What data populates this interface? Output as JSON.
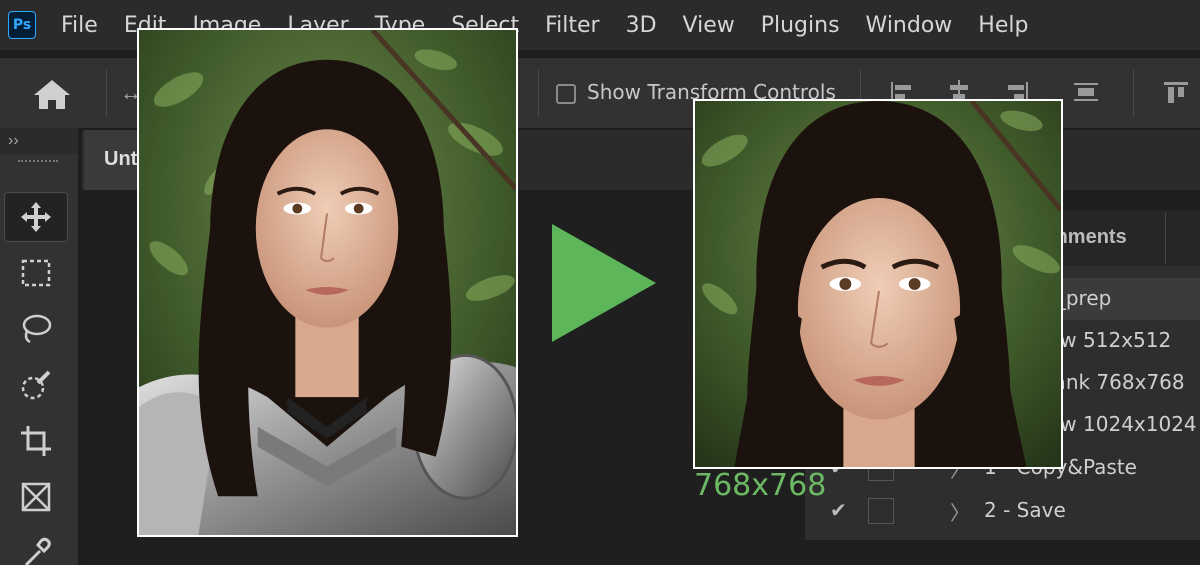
{
  "app": {
    "logo": "Ps"
  },
  "menu": [
    "File",
    "Edit",
    "Image",
    "Layer",
    "Type",
    "Select",
    "Filter",
    "3D",
    "View",
    "Plugins",
    "Window",
    "Help"
  ],
  "options_bar": {
    "show_transform_controls": "Show Transform Controls",
    "checked": false
  },
  "document": {
    "tab_title_fragment": "Unt"
  },
  "actions_panel": {
    "tab_label": "mments",
    "rows": [
      {
        "text": "t_prep",
        "selected": true
      },
      {
        "text": "ew 512x512"
      },
      {
        "text": "lank 768x768"
      },
      {
        "text": "ew 1024x1024"
      }
    ],
    "steps": [
      {
        "label": "1 - Copy&Paste",
        "check": "✔"
      },
      {
        "label": "2 - Save",
        "check": "✔"
      }
    ]
  },
  "overlay": {
    "size_label": "768x768",
    "arrow_color": "#5db75a",
    "label_color": "#6cb864"
  },
  "tools": [
    "move-tool",
    "marquee-tool",
    "lasso-tool",
    "quick-selection-tool",
    "crop-tool",
    "frame-tool",
    "eyedropper-tool"
  ]
}
